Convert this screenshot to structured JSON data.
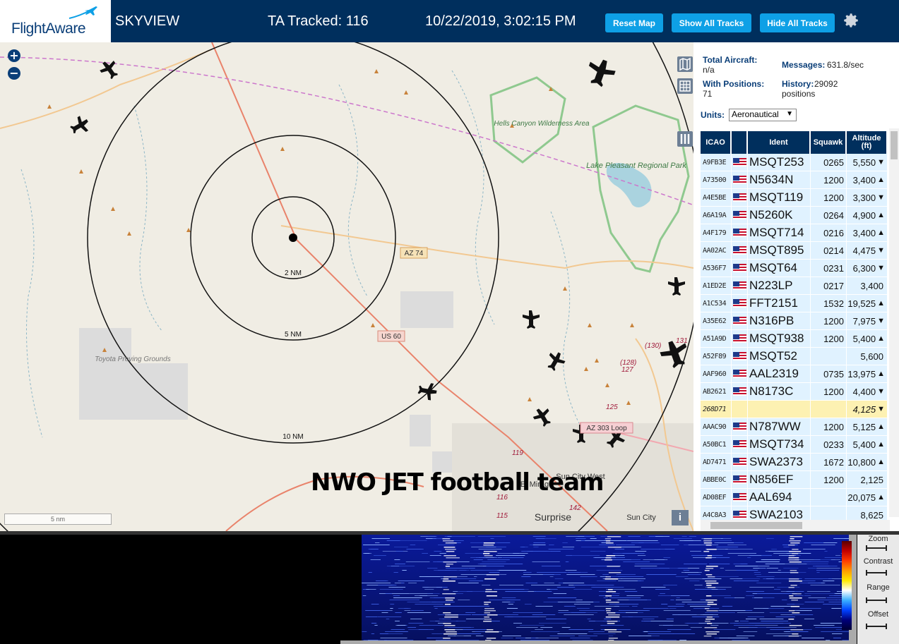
{
  "header": {
    "logo_text": "FlightAware",
    "app_title": "SKYVIEW",
    "tracked": "TA Tracked: 116",
    "datetime": "10/22/2019, 3:02:15 PM",
    "buttons": {
      "reset_map": "Reset Map",
      "show_all": "Show All Tracks",
      "hide_all": "Hide All Tracks"
    }
  },
  "map": {
    "zoom_in": "+",
    "zoom_out": "−",
    "range_labels": [
      "2 NM",
      "5 NM",
      "10 NM"
    ],
    "road_labels": [
      "AZ 74",
      "US 60",
      "AZ 303 Loop",
      "(130)",
      "127",
      "(128)",
      "125",
      "131",
      "119",
      "116",
      "115",
      "142"
    ],
    "place_labels": [
      "Hells Canyon Wilderness Area",
      "Lake Pleasant Regional Park",
      "Toyota Proving Grounds",
      "Sun City West",
      "Surprise",
      "Sun City",
      "El Mirage"
    ],
    "scale_label": "5 nm",
    "caption": "NWO JET football team",
    "info_label": "i"
  },
  "sidebar": {
    "total_aircraft_label": "Total Aircraft:",
    "total_aircraft_value": "n/a",
    "messages_label": "Messages:",
    "messages_value": "631.8/sec",
    "with_positions_label": "With Positions:",
    "with_positions_value": "71",
    "history_label": "History:",
    "history_value": "29092 positions",
    "units_label": "Units:",
    "units_value": "Aeronautical",
    "columns": {
      "icao": "ICAO",
      "ident": "Ident",
      "squawk": "Squawk",
      "altitude": "Altitude (ft)"
    },
    "rows": [
      {
        "icao": "A9FB3E",
        "flag": true,
        "ident": "MSQT253",
        "squawk": "0265",
        "altitude": "5,550",
        "trend": "▼"
      },
      {
        "icao": "A73500",
        "flag": true,
        "ident": "N5634N",
        "squawk": "1200",
        "altitude": "3,400",
        "trend": "▲"
      },
      {
        "icao": "A4E5BE",
        "flag": true,
        "ident": "MSQT119",
        "squawk": "1200",
        "altitude": "3,300",
        "trend": "▼"
      },
      {
        "icao": "A6A19A",
        "flag": true,
        "ident": "N5260K",
        "squawk": "0264",
        "altitude": "4,900",
        "trend": "▲"
      },
      {
        "icao": "A4F179",
        "flag": true,
        "ident": "MSQT714",
        "squawk": "0216",
        "altitude": "3,400",
        "trend": "▲"
      },
      {
        "icao": "AA02AC",
        "flag": true,
        "ident": "MSQT895",
        "squawk": "0214",
        "altitude": "4,475",
        "trend": "▼"
      },
      {
        "icao": "A536F7",
        "flag": true,
        "ident": "MSQT64",
        "squawk": "0231",
        "altitude": "6,300",
        "trend": "▼"
      },
      {
        "icao": "A1ED2E",
        "flag": true,
        "ident": "N223LP",
        "squawk": "0217",
        "altitude": "3,400",
        "trend": ""
      },
      {
        "icao": "A1C534",
        "flag": true,
        "ident": "FFT2151",
        "squawk": "1532",
        "altitude": "19,525",
        "trend": "▲"
      },
      {
        "icao": "A35E62",
        "flag": true,
        "ident": "N316PB",
        "squawk": "1200",
        "altitude": "7,975",
        "trend": "▼"
      },
      {
        "icao": "A51A9D",
        "flag": true,
        "ident": "MSQT938",
        "squawk": "1200",
        "altitude": "5,400",
        "trend": "▲"
      },
      {
        "icao": "A52F89",
        "flag": true,
        "ident": "MSQT52",
        "squawk": "",
        "altitude": "5,600",
        "trend": ""
      },
      {
        "icao": "AAF960",
        "flag": true,
        "ident": "AAL2319",
        "squawk": "0735",
        "altitude": "13,975",
        "trend": "▲"
      },
      {
        "icao": "AB2621",
        "flag": true,
        "ident": "N8173C",
        "squawk": "1200",
        "altitude": "4,400",
        "trend": "▼"
      },
      {
        "icao": "268D71",
        "flag": false,
        "ident": "",
        "squawk": "",
        "altitude": "4,125",
        "trend": "▼",
        "highlight": true
      },
      {
        "icao": "AAAC90",
        "flag": true,
        "ident": "N787WW",
        "squawk": "1200",
        "altitude": "5,125",
        "trend": "▲"
      },
      {
        "icao": "A50BC1",
        "flag": true,
        "ident": "MSQT734",
        "squawk": "0233",
        "altitude": "5,400",
        "trend": "▲"
      },
      {
        "icao": "AD7471",
        "flag": true,
        "ident": "SWA2373",
        "squawk": "1672",
        "altitude": "10,800",
        "trend": "▲"
      },
      {
        "icao": "ABBE0C",
        "flag": true,
        "ident": "N856EF",
        "squawk": "1200",
        "altitude": "2,125",
        "trend": ""
      },
      {
        "icao": "AD08EF",
        "flag": true,
        "ident": "AAL694",
        "squawk": "",
        "altitude": "20,075",
        "trend": "▲"
      },
      {
        "icao": "A4C8A3",
        "flag": true,
        "ident": "SWA2103",
        "squawk": "",
        "altitude": "8,625",
        "trend": ""
      }
    ]
  },
  "waterfall": {
    "controls": [
      "Zoom",
      "Contrast",
      "Range",
      "Offset"
    ]
  },
  "colors": {
    "header_bg": "#002f5d",
    "button": "#0ea0e6",
    "row_bg": "#e0f2ff",
    "row_highlight": "#fdf1b2"
  }
}
